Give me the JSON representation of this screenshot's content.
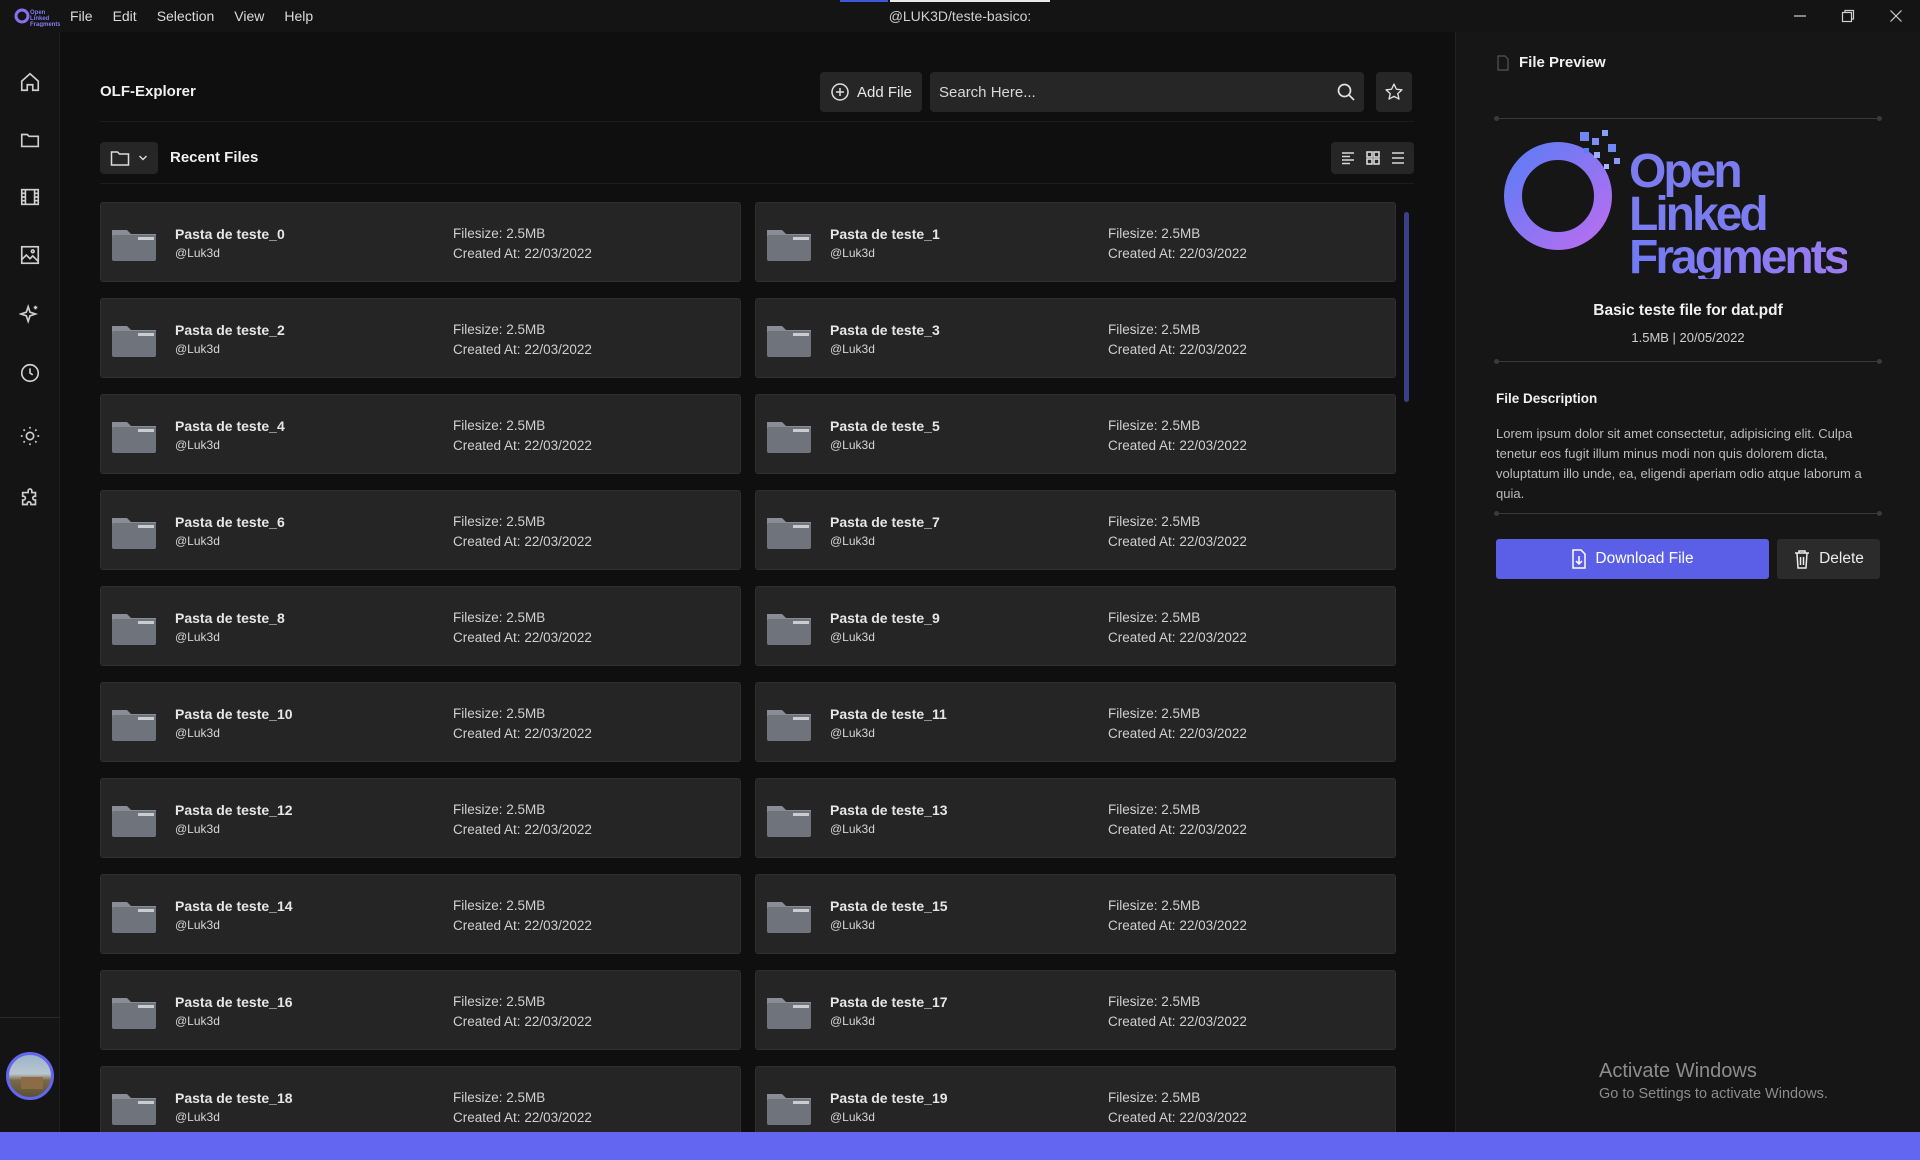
{
  "titlebar": {
    "title": "@LUK3D/teste-basico:",
    "menu": [
      "File",
      "Edit",
      "Selection",
      "View",
      "Help"
    ],
    "logo_text": "Open Linked Fragments"
  },
  "sidebar": {
    "items": [
      {
        "name": "home-icon"
      },
      {
        "name": "folder-icon"
      },
      {
        "name": "film-icon"
      },
      {
        "name": "image-icon"
      },
      {
        "name": "sparkle-icon"
      },
      {
        "name": "clock-icon"
      },
      {
        "name": "sun-icon"
      },
      {
        "name": "puzzle-icon"
      }
    ]
  },
  "explorer": {
    "title": "OLF-Explorer",
    "add_file_label": "Add File",
    "search_placeholder": "Search Here...",
    "section_title": "Recent Files",
    "filesize_label": "Filesize:",
    "created_label": "Created At:"
  },
  "files": [
    {
      "name": "Pasta de teste_0",
      "user": "@Luk3d",
      "size": "2.5MB",
      "created": "22/03/2022"
    },
    {
      "name": "Pasta de teste_1",
      "user": "@Luk3d",
      "size": "2.5MB",
      "created": "22/03/2022"
    },
    {
      "name": "Pasta de teste_2",
      "user": "@Luk3d",
      "size": "2.5MB",
      "created": "22/03/2022"
    },
    {
      "name": "Pasta de teste_3",
      "user": "@Luk3d",
      "size": "2.5MB",
      "created": "22/03/2022"
    },
    {
      "name": "Pasta de teste_4",
      "user": "@Luk3d",
      "size": "2.5MB",
      "created": "22/03/2022"
    },
    {
      "name": "Pasta de teste_5",
      "user": "@Luk3d",
      "size": "2.5MB",
      "created": "22/03/2022"
    },
    {
      "name": "Pasta de teste_6",
      "user": "@Luk3d",
      "size": "2.5MB",
      "created": "22/03/2022"
    },
    {
      "name": "Pasta de teste_7",
      "user": "@Luk3d",
      "size": "2.5MB",
      "created": "22/03/2022"
    },
    {
      "name": "Pasta de teste_8",
      "user": "@Luk3d",
      "size": "2.5MB",
      "created": "22/03/2022"
    },
    {
      "name": "Pasta de teste_9",
      "user": "@Luk3d",
      "size": "2.5MB",
      "created": "22/03/2022"
    },
    {
      "name": "Pasta de teste_10",
      "user": "@Luk3d",
      "size": "2.5MB",
      "created": "22/03/2022"
    },
    {
      "name": "Pasta de teste_11",
      "user": "@Luk3d",
      "size": "2.5MB",
      "created": "22/03/2022"
    },
    {
      "name": "Pasta de teste_12",
      "user": "@Luk3d",
      "size": "2.5MB",
      "created": "22/03/2022"
    },
    {
      "name": "Pasta de teste_13",
      "user": "@Luk3d",
      "size": "2.5MB",
      "created": "22/03/2022"
    },
    {
      "name": "Pasta de teste_14",
      "user": "@Luk3d",
      "size": "2.5MB",
      "created": "22/03/2022"
    },
    {
      "name": "Pasta de teste_15",
      "user": "@Luk3d",
      "size": "2.5MB",
      "created": "22/03/2022"
    },
    {
      "name": "Pasta de teste_16",
      "user": "@Luk3d",
      "size": "2.5MB",
      "created": "22/03/2022"
    },
    {
      "name": "Pasta de teste_17",
      "user": "@Luk3d",
      "size": "2.5MB",
      "created": "22/03/2022"
    },
    {
      "name": "Pasta de teste_18",
      "user": "@Luk3d",
      "size": "2.5MB",
      "created": "22/03/2022"
    },
    {
      "name": "Pasta de teste_19",
      "user": "@Luk3d",
      "size": "2.5MB",
      "created": "22/03/2022"
    }
  ],
  "preview": {
    "title": "File Preview",
    "logo_lines": [
      "Open",
      "Linked",
      "Fragments"
    ],
    "file_name": "Basic teste file for dat.pdf",
    "file_meta": "1.5MB | 20/05/2022",
    "description_title": "File Description",
    "description": "Lorem ipsum dolor sit amet consectetur, adipisicing elit. Culpa tenetur eos fugit illum minus modi non quis dolorem dicta, voluptatum illo unde, ea, eligendi aperiam odio atque laborum a quia.",
    "download_label": "Download File",
    "delete_label": "Delete"
  },
  "watermark": {
    "line1": "Activate Windows",
    "line2": "Go to Settings to activate Windows."
  },
  "colors": {
    "accent": "#6366f1",
    "background": "#0f0f0f",
    "card": "#252525"
  }
}
